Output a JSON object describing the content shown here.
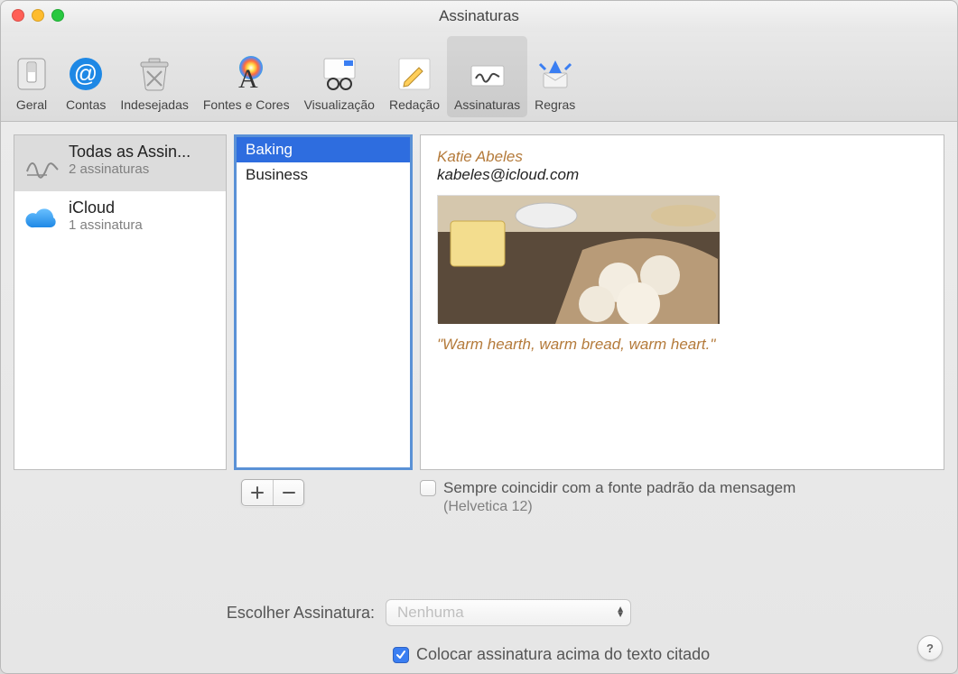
{
  "window": {
    "title": "Assinaturas"
  },
  "toolbar": {
    "items": [
      {
        "label": "Geral"
      },
      {
        "label": "Contas"
      },
      {
        "label": "Indesejadas"
      },
      {
        "label": "Fontes e Cores"
      },
      {
        "label": "Visualização"
      },
      {
        "label": "Redação"
      },
      {
        "label": "Assinaturas"
      },
      {
        "label": "Regras"
      }
    ],
    "selected_index": 6
  },
  "accounts": [
    {
      "name": "Todas as Assin...",
      "count_label": "2 assinaturas"
    },
    {
      "name": "iCloud",
      "count_label": "1 assinatura"
    }
  ],
  "accounts_selected_index": 0,
  "signatures": [
    {
      "label": "Baking"
    },
    {
      "label": "Business"
    }
  ],
  "signatures_selected_index": 0,
  "preview": {
    "display_name": "Katie Abeles",
    "email": "kabeles@icloud.com",
    "tagline": "\"Warm hearth, warm bread, warm heart.\""
  },
  "options": {
    "match_default_font_label": "Sempre coincidir com a fonte padrão da mensagem",
    "font_hint": "(Helvetica 12)",
    "match_default_font_checked": false,
    "choose_label": "Escolher Assinatura:",
    "choose_value": "Nenhuma",
    "place_above_quote_label": "Colocar assinatura acima do texto citado",
    "place_above_quote_checked": true
  },
  "glyphs": {
    "help": "?"
  }
}
